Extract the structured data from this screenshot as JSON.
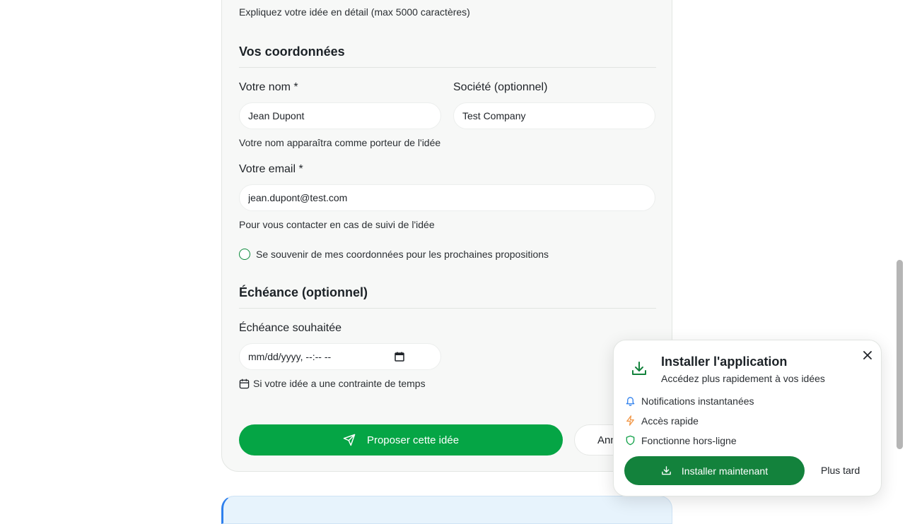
{
  "form": {
    "description_hint": "Expliquez votre idée en détail (max 5000 caractères)",
    "contact_section_title": "Vos coordonnées",
    "name_label": "Votre nom *",
    "name_value": "Jean Dupont",
    "company_label": "Société (optionnel)",
    "company_value": "Test Company",
    "name_hint": "Votre nom apparaîtra comme porteur de l'idée",
    "email_label": "Votre email *",
    "email_value": "jean.dupont@test.com",
    "email_hint": "Pour vous contacter en cas de suivi de l'idée",
    "remember_label": "Se souvenir de mes coordonnées pour les prochaines propositions",
    "deadline_section_title": "Échéance (optionnel)",
    "deadline_label": "Échéance souhaitée",
    "deadline_placeholder": "mm/dd/yyyy, --:-- --",
    "deadline_hint": "Si votre idée a une contrainte de temps",
    "submit_label": "Proposer cette idée",
    "cancel_label": "Annuler"
  },
  "install_popup": {
    "title": "Installer l'application",
    "subtitle": "Accédez plus rapidement à vos idées",
    "features": [
      {
        "label": "Notifications instantanées",
        "icon": "bell-icon",
        "color": "#2f80ed"
      },
      {
        "label": "Accès rapide",
        "icon": "lightning-icon",
        "color": "#f2994a"
      },
      {
        "label": "Fonctionne hors-ligne",
        "icon": "shield-icon",
        "color": "#13a24a"
      }
    ],
    "install_button_label": "Installer maintenant",
    "later_label": "Plus tard"
  },
  "colors": {
    "primary_green": "#05a545",
    "install_green": "#13823c",
    "info_blue": "#e7f3fc"
  }
}
